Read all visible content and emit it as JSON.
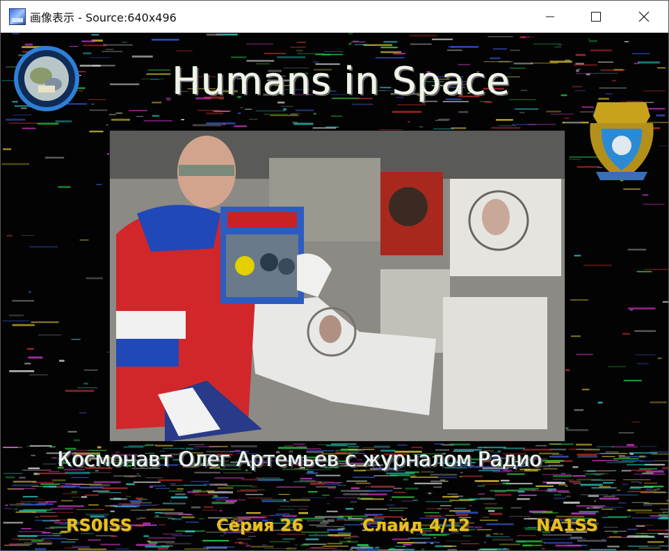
{
  "window": {
    "title": "画像表示 - Source:640x496",
    "controls": {
      "minimize": "minimize-icon",
      "maximize": "maximize-icon",
      "close": "close-icon"
    }
  },
  "image": {
    "heading": "Humans in Space",
    "caption": "Космонавт Олег Артемьев с журналом Радио",
    "footer": [
      "RS0ISS",
      "Серия 26",
      "Слайд 4/12",
      "NA1SS"
    ],
    "colors": {
      "heading": "#f2f2ea",
      "caption": "#f2f2f2",
      "footer": "#e7c020"
    }
  }
}
